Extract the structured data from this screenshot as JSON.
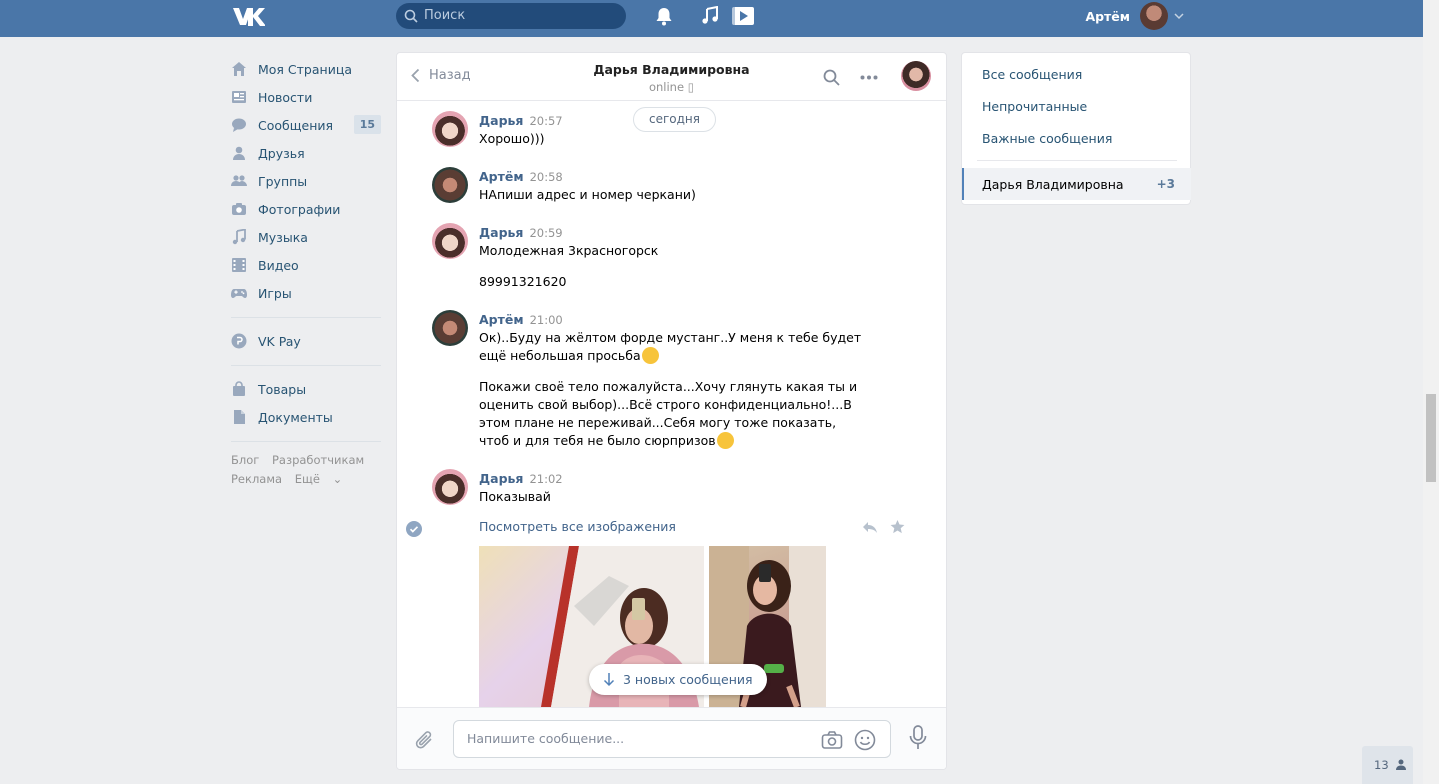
{
  "header": {
    "logo": "VK",
    "search_placeholder": "Поиск",
    "user_name": "Артём"
  },
  "nav": {
    "items": [
      {
        "label": "Моя Страница",
        "icon": "home-icon"
      },
      {
        "label": "Новости",
        "icon": "news-icon"
      },
      {
        "label": "Сообщения",
        "icon": "messages-icon",
        "badge": "15"
      },
      {
        "label": "Друзья",
        "icon": "friends-icon"
      },
      {
        "label": "Группы",
        "icon": "groups-icon"
      },
      {
        "label": "Фотографии",
        "icon": "camera-icon"
      },
      {
        "label": "Музыка",
        "icon": "music-icon"
      },
      {
        "label": "Видео",
        "icon": "video-icon"
      },
      {
        "label": "Игры",
        "icon": "games-icon"
      }
    ],
    "vkpay": "VK Pay",
    "extra": [
      "Товары",
      "Документы"
    ],
    "footer": {
      "blog": "Блог",
      "dev": "Разработчикам",
      "ads": "Реклама",
      "more": "Ещё"
    }
  },
  "chat": {
    "back_label": "Назад",
    "peer_name": "Дарья Владимировна",
    "peer_status": "online",
    "date_chip": "сегодня",
    "messages": [
      {
        "author": "Дарья",
        "time": "20:57",
        "lines": [
          "Хорошо)))"
        ]
      },
      {
        "author": "Артём",
        "time": "20:58",
        "lines": [
          "НАпиши адрес и номер черкани)"
        ]
      },
      {
        "author": "Дарья",
        "time": "20:59",
        "lines": [
          "Молодежная 3красногорск",
          "89991321620"
        ]
      },
      {
        "author": "Артём",
        "time": "21:00",
        "lines": [
          "Ок)..Буду на жёлтом форде мустанг..У меня к тебе будет ещё небольшая просьба",
          "Покажи своё тело пожалуйста...Хочу глянуть какая ты и оценить свой выбор)...Всё строго конфиденциально!...В этом плане не переживай...Себя могу тоже показать, чтоб и для тебя не было сюрпризов"
        ]
      },
      {
        "author": "Дарья",
        "time": "21:02",
        "lines": [
          "Показывай"
        ]
      }
    ],
    "view_all_images": "Посмотреть все изображения",
    "new_messages": "3 новых сообщения",
    "input_placeholder": "Напишите сообщение..."
  },
  "right_panel": {
    "all": "Все сообщения",
    "unread": "Непрочитанные",
    "important": "Важные сообщения",
    "selected_name": "Дарья Владимировна",
    "selected_count": "+3"
  },
  "online_counter": "13",
  "colors": {
    "header": "#4a76a8",
    "link": "#42648b",
    "background": "#edeef0"
  }
}
